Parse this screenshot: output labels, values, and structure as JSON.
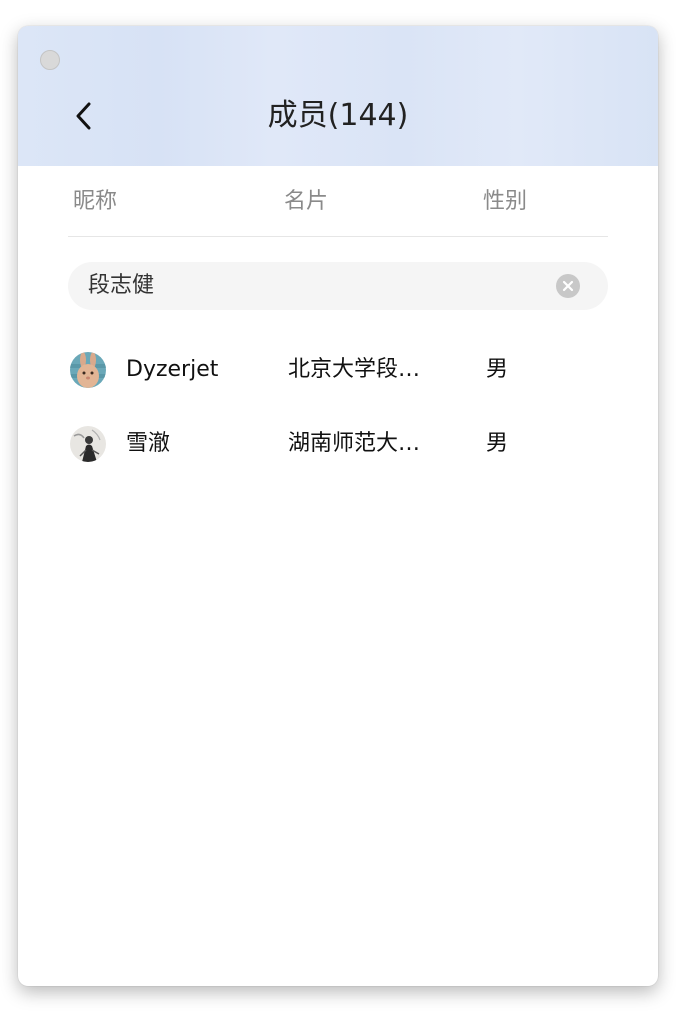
{
  "header": {
    "title": "成员(144)",
    "background_color": "#dce6f7"
  },
  "tabs": [
    {
      "label": "昵称"
    },
    {
      "label": "名片"
    },
    {
      "label": "性别"
    }
  ],
  "search": {
    "value": "段志健"
  },
  "members": [
    {
      "nickname": "Dyzerjet",
      "card": "北京大学段志健",
      "gender": "男",
      "avatar_icon": "rabbit-avatar-icon"
    },
    {
      "nickname": "雪澈",
      "card": "湖南师范大学段志健",
      "gender": "男",
      "avatar_icon": "ink-figure-avatar-icon"
    }
  ],
  "icons": {
    "back": "chevron-left-icon",
    "clear": "clear-circle-icon",
    "window_control": "window-close-button"
  }
}
